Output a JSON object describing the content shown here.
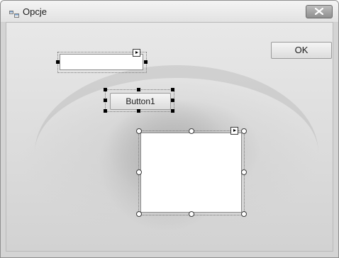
{
  "window": {
    "title": "Opcje",
    "icons": {
      "app": "form-icon",
      "close": "close-icon"
    }
  },
  "form": {
    "ok_button_label": "OK",
    "button1_label": "Button1",
    "textbox_value": "",
    "panel_text": ""
  },
  "designer": {
    "selection_handles": "sizing-handles",
    "smart_tag_icon": "smart-tag-arrow-icon"
  },
  "colors": {
    "titlebar": "#ececec",
    "close_button": "#a8a8a8",
    "form_background": "#d4d4d4"
  }
}
